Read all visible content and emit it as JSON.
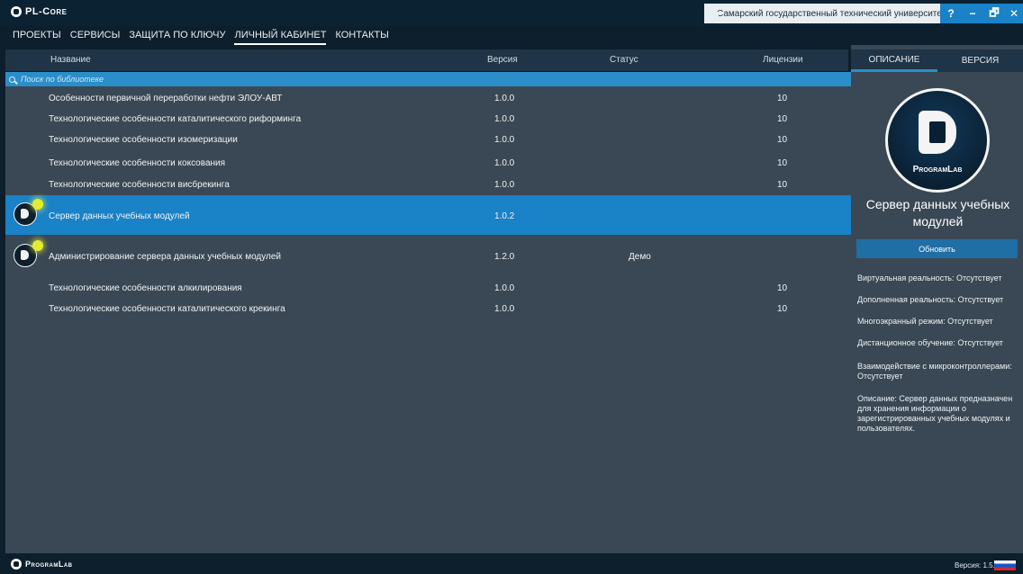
{
  "app": {
    "title": "PL-Core",
    "university": "Самарский государственный технический университет"
  },
  "window_controls": {
    "help": "?",
    "minimize": "−",
    "maximize": "🗗",
    "close": "✕"
  },
  "nav": [
    "ПРОЕКТЫ",
    "СЕРВИСЫ",
    "ЗАЩИТА ПО КЛЮЧУ",
    "ЛИЧНЫЙ КАБИНЕТ",
    "КОНТАКТЫ"
  ],
  "nav_active": "ЛИЧНЫЙ КАБИНЕТ",
  "table": {
    "columns": {
      "name": "Название",
      "version": "Версия",
      "status": "Статус",
      "licenses": "Лицензии"
    },
    "search_placeholder": "Поиск по библиотеке",
    "rows": [
      {
        "name": "Особенности первичной переработки нефти ЭЛОУ-АВТ",
        "version": "1.0.0",
        "status": "",
        "licenses": "10"
      },
      {
        "name": "Технологические особенности каталитического риформинга",
        "version": "1.0.0",
        "status": "",
        "licenses": "10"
      },
      {
        "name": "Технологические особенности изомеризации",
        "version": "1.0.0",
        "status": "",
        "licenses": "10"
      },
      {
        "name": "Технологические особенности коксования",
        "version": "1.0.0",
        "status": "",
        "licenses": "10"
      },
      {
        "name": "Технологические особенности висбрекинга",
        "version": "1.0.0",
        "status": "",
        "licenses": "10"
      },
      {
        "name": "Сервер данных учебных модулей",
        "version": "1.0.2",
        "status": "",
        "licenses": ""
      },
      {
        "name": "Администрирование сервера данных учебных модулей",
        "version": "1.2.0",
        "status": "Демо",
        "licenses": ""
      },
      {
        "name": "Технологические особенности алкилирования",
        "version": "1.0.0",
        "status": "",
        "licenses": "10"
      },
      {
        "name": "Технологические особенности каталитического крекинга",
        "version": "1.0.0",
        "status": "",
        "licenses": "10"
      }
    ]
  },
  "side_panel": {
    "tabs": [
      "ОПИСАНИЕ",
      "ВЕРСИЯ"
    ],
    "logo_text": "ProgramLab",
    "module_title": "Сервер данных учебных модулей",
    "update_button": "Обновить",
    "info": [
      "Виртуальная реальность: Отсутствует",
      "Дополненная реальность: Отсутствует",
      "Многоэкранный режим: Отсутствует",
      "Дистанционное обучение: Отсутствует",
      "Взаимодействие с микроконтроллерами: Отсутствует",
      "Описание: Сервер данных предназначен для хранения информации о зарегистрированных учебных модулях и пользователях."
    ]
  },
  "footer": {
    "brand": "ProgramLab",
    "version": "Версия: 1.5.2"
  }
}
